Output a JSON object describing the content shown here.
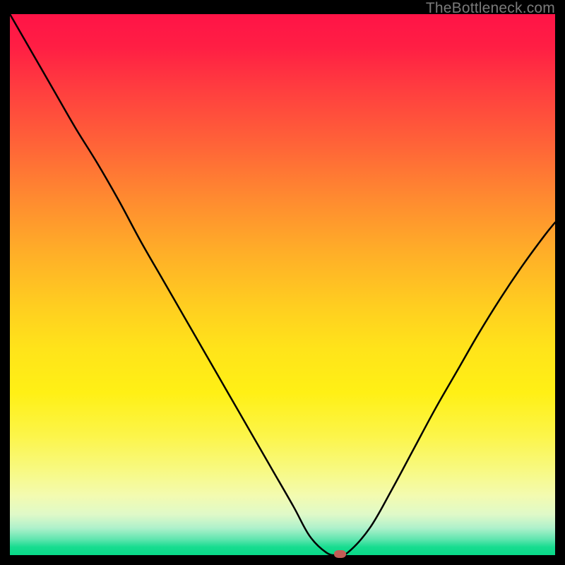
{
  "watermark": "TheBottleneck.com",
  "colors": {
    "frame": "#000000",
    "curve_stroke": "#000000",
    "marker_fill": "#c25d56",
    "gradient_top": "#ff1447",
    "gradient_bottom": "#08d988"
  },
  "chart_data": {
    "type": "line",
    "title": "",
    "xlabel": "",
    "ylabel": "",
    "xlim": [
      0,
      100
    ],
    "ylim": [
      0,
      100
    ],
    "x": [
      0,
      4,
      8,
      12,
      16,
      20,
      24,
      28,
      32,
      36,
      40,
      44,
      48,
      52,
      55,
      58,
      60,
      62,
      66,
      70,
      74,
      78,
      82,
      86,
      90,
      94,
      98,
      100
    ],
    "values": [
      100,
      93,
      86,
      79,
      72.5,
      65.5,
      58,
      51,
      44,
      37,
      30,
      23,
      16,
      9,
      3.5,
      0.5,
      0,
      0.5,
      5,
      12,
      19.5,
      27,
      34,
      41,
      47.5,
      53.5,
      59,
      61.5
    ],
    "marker": {
      "x": 60.5,
      "y": 0
    }
  }
}
